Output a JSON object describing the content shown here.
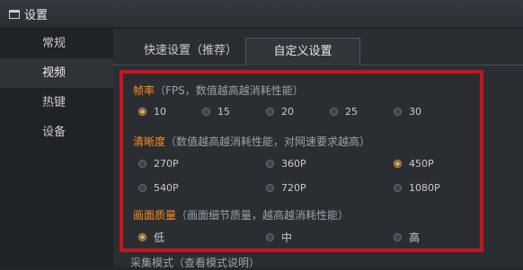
{
  "window": {
    "title": "设置"
  },
  "sidebar": {
    "items": [
      {
        "label": "常规"
      },
      {
        "label": "视频"
      },
      {
        "label": "热键"
      },
      {
        "label": "设备"
      }
    ]
  },
  "tabs": [
    {
      "label": "快速设置（推荐）"
    },
    {
      "label": "自定义设置"
    }
  ],
  "framerate": {
    "label": "帧率",
    "hint": "（FPS，数值越高越消耗性能）",
    "options": [
      "10",
      "15",
      "20",
      "25",
      "30"
    ],
    "selected": "10"
  },
  "resolution": {
    "label": "清晰度",
    "hint": "（数值越高越消耗性能，对网速要求越高）",
    "options": [
      "270P",
      "360P",
      "450P",
      "540P",
      "720P",
      "1080P"
    ],
    "selected": "450P"
  },
  "quality": {
    "label": "画面质量",
    "hint": "（画面细节质量，越高越消耗性能）",
    "options": [
      "低",
      "中",
      "高"
    ],
    "selected": "低"
  },
  "capture": {
    "label": "采集模式",
    "hint": "（查看模式说明）"
  },
  "colors": {
    "accent": "#ff8a1e",
    "highlight_border": "#c8141c",
    "background": "#2a2d32"
  }
}
